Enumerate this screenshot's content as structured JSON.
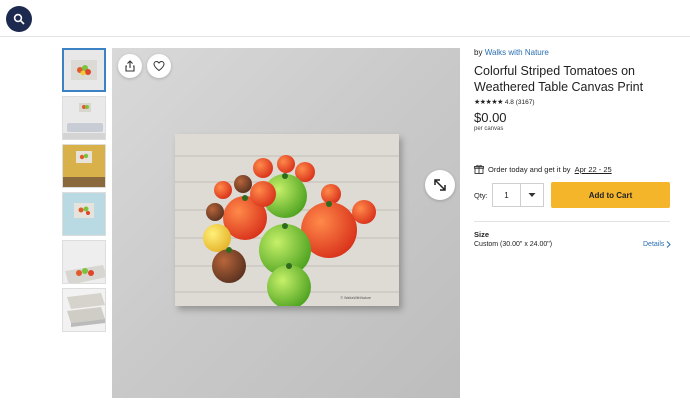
{
  "header": {
    "search_icon": "search-icon"
  },
  "gallery": {
    "thumbnails": [
      {
        "name": "thumb-front-view",
        "selected": true
      },
      {
        "name": "thumb-living-room",
        "selected": false
      },
      {
        "name": "thumb-yellow-wall",
        "selected": false
      },
      {
        "name": "thumb-blue-wall",
        "selected": false
      },
      {
        "name": "thumb-angled-view",
        "selected": false
      },
      {
        "name": "thumb-stack-view",
        "selected": false
      }
    ],
    "share_icon": "share-icon",
    "favorite_icon": "heart-icon",
    "expand_icon": "expand-icon",
    "watermark": "© WalksWithNature"
  },
  "product": {
    "by_prefix": "by",
    "seller": "Walks with Nature",
    "title": "Colorful Striped Tomatoes on Weathered Table Canvas Print",
    "stars": "★★★★★",
    "rating": "4.8 (3167)",
    "price": "$0.00",
    "per_unit": "per canvas",
    "order_text": "Order today and get it by",
    "order_date": "Apr 22 - 25",
    "qty_label": "Qty:",
    "qty_value": "1",
    "add_to_cart": "Add to Cart",
    "size_heading": "Size",
    "size_value": "Custom (30.00\" x 24.00\")",
    "details_label": "Details"
  },
  "colors": {
    "accent": "#f4b52b",
    "link": "#2b6fb3",
    "nav": "#1d2a4f"
  }
}
